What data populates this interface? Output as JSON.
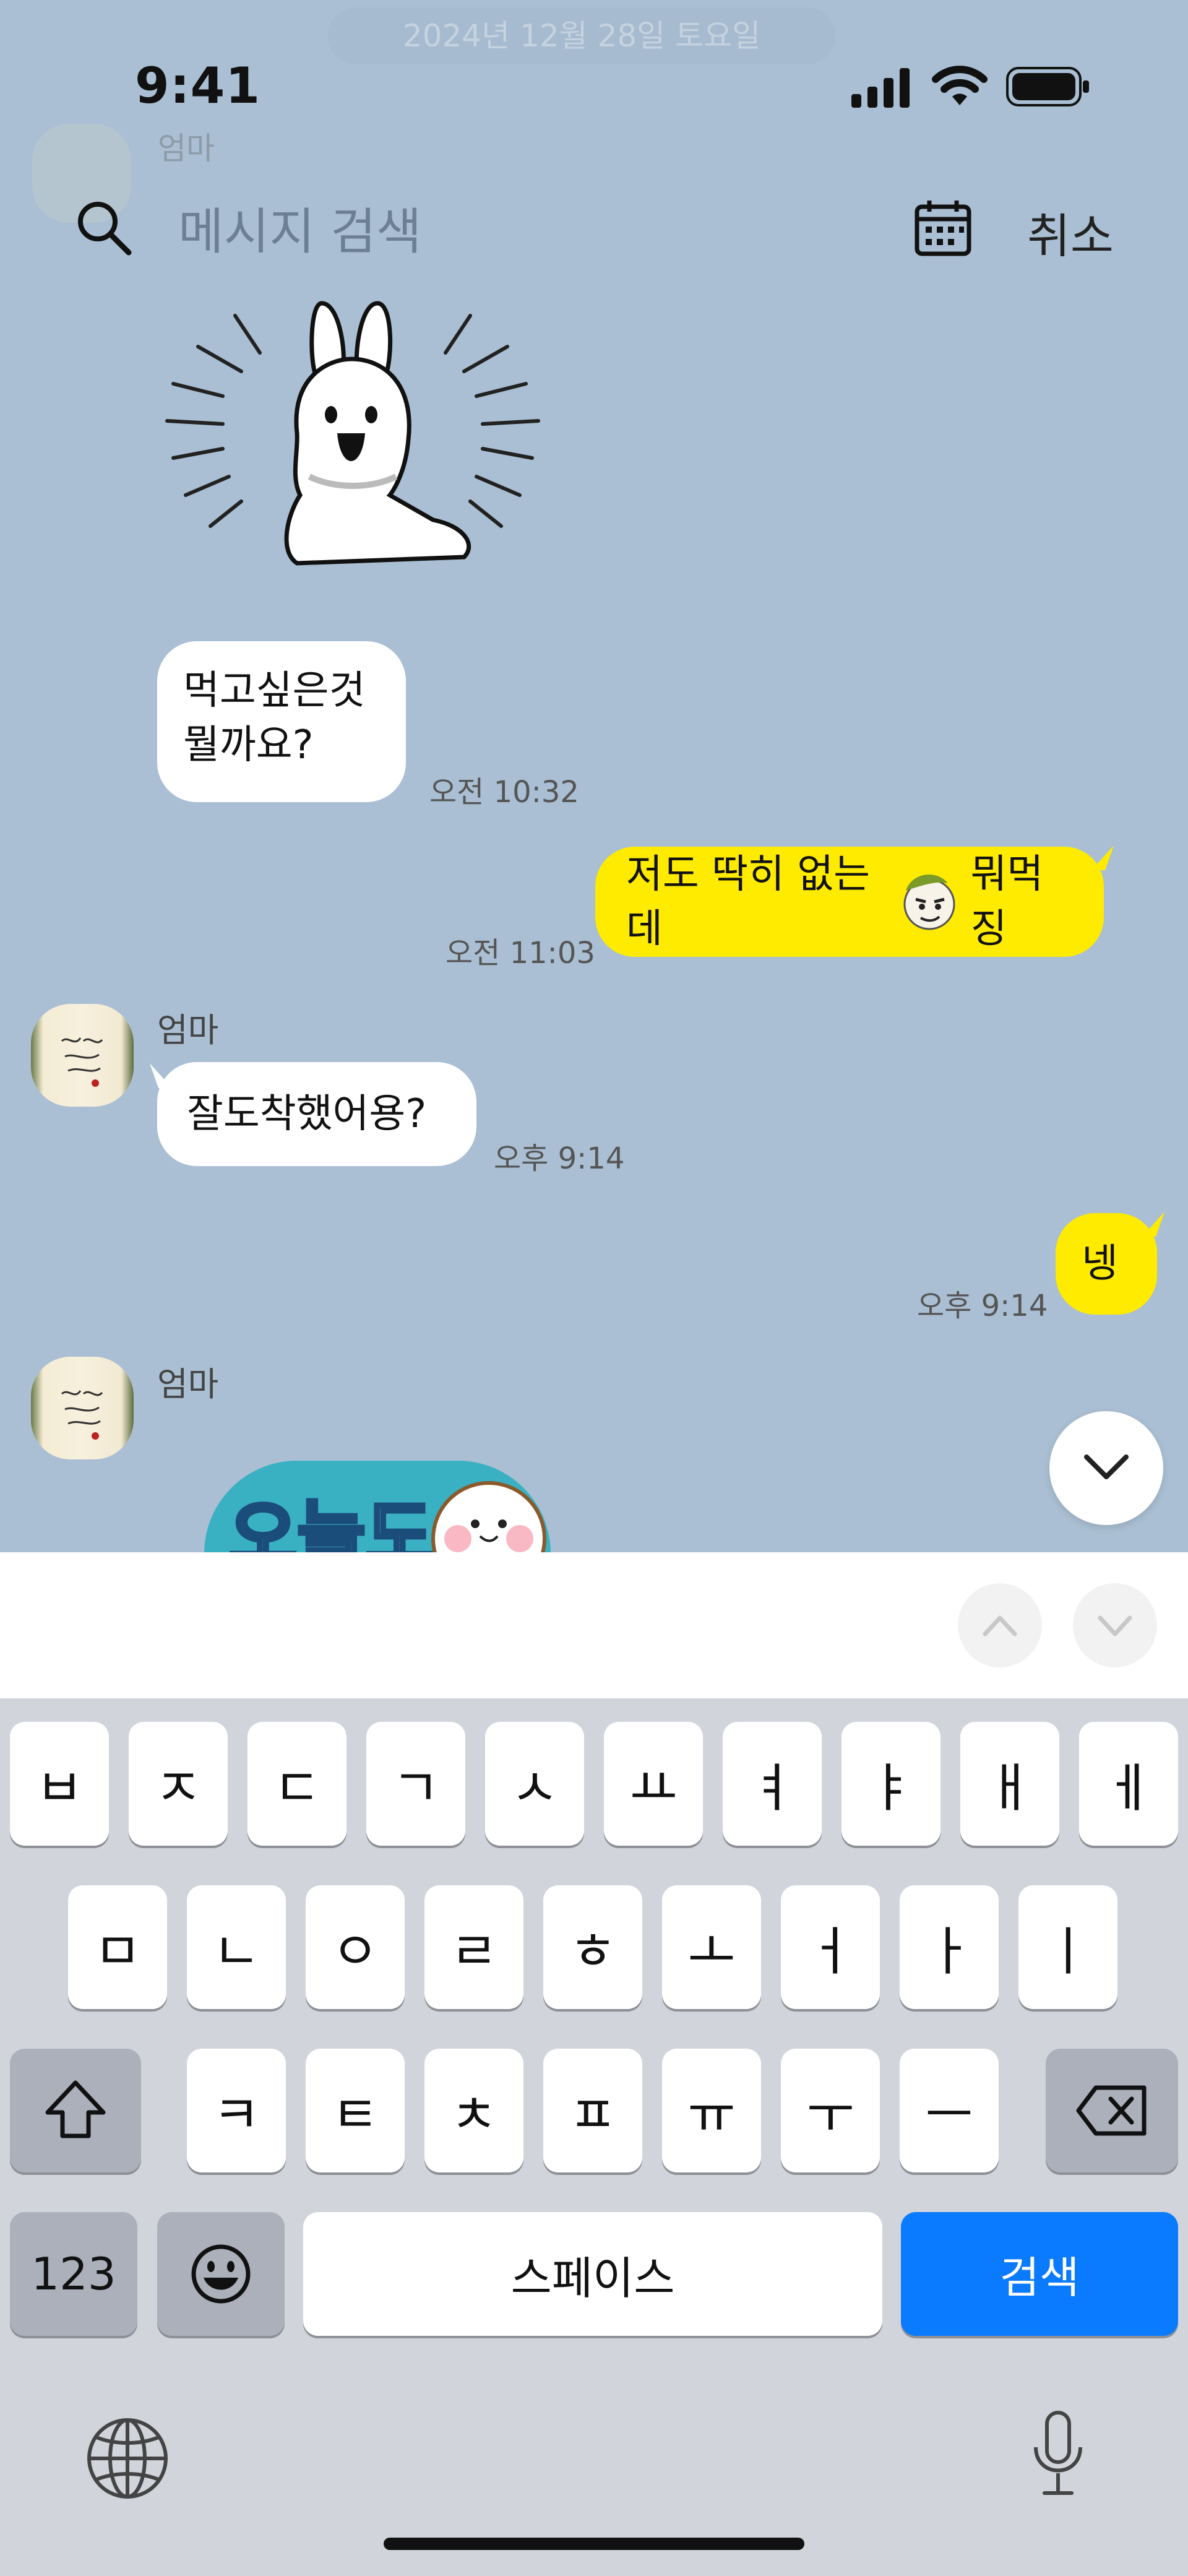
{
  "status_bar": {
    "time": "9:41"
  },
  "date_pill": "2024년 12월 28일 토요일",
  "search": {
    "placeholder": "메시지 검색",
    "cancel_label": "취소"
  },
  "messages": [
    {
      "side": "left",
      "type": "sticker",
      "description": "rabbit sticker"
    },
    {
      "side": "left",
      "type": "text",
      "lines": [
        "먹고싶은것",
        "뭘까요?"
      ],
      "time": "오전 10:32"
    },
    {
      "side": "right",
      "type": "text",
      "text_before": "저도 딱히 없는데",
      "emoji": "sticker-face",
      "text_after": "뭐먹징",
      "time": "오전 11:03"
    },
    {
      "side": "left",
      "sender": "엄마",
      "type": "text",
      "text": "잘도착했어용?",
      "time": "오후 9:14"
    },
    {
      "side": "right",
      "type": "text",
      "text": "넹",
      "time": "오후 9:14"
    },
    {
      "side": "left",
      "sender": "엄마",
      "type": "sticker",
      "sticker_text": "오늘도"
    }
  ],
  "keyboard": {
    "row1": [
      "ㅂ",
      "ㅈ",
      "ㄷ",
      "ㄱ",
      "ㅅ",
      "ㅛ",
      "ㅕ",
      "ㅑ",
      "ㅐ",
      "ㅔ"
    ],
    "row2": [
      "ㅁ",
      "ㄴ",
      "ㅇ",
      "ㄹ",
      "ㅎ",
      "ㅗ",
      "ㅓ",
      "ㅏ",
      "ㅣ"
    ],
    "row3": [
      "ㅋ",
      "ㅌ",
      "ㅊ",
      "ㅍ",
      "ㅠ",
      "ㅜ",
      "ㅡ"
    ],
    "numbers_label": "123",
    "space_label": "스페이스",
    "search_label": "검색"
  },
  "colors": {
    "chat_bg": "#aabfd3",
    "my_bubble": "#ffeb00",
    "accent_blue": "#0a7aff"
  }
}
